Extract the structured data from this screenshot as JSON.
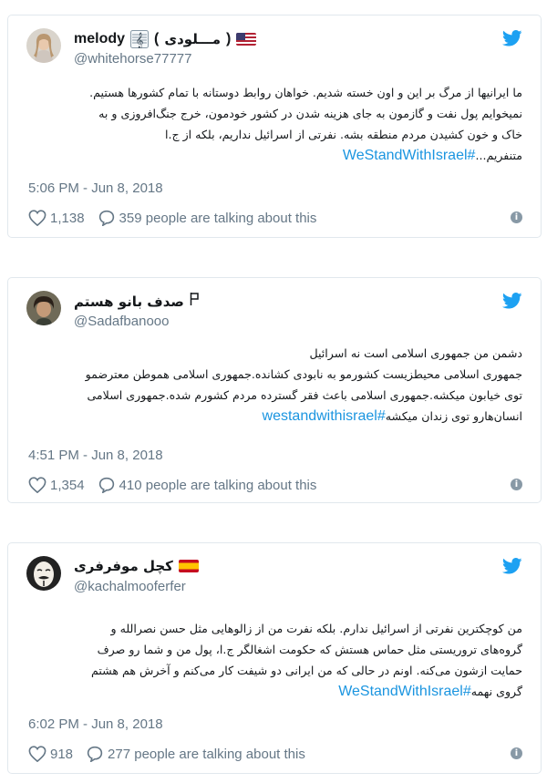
{
  "tweets": [
    {
      "display_name": "melody",
      "name_extra_open": "(",
      "name_rtl": "مـــلودی",
      "name_extra_close": ")",
      "handle": "@whitehorse77777",
      "lines": [
        "ما ایرانیها از مرگ بر این و اون خسته شدیم. خواهان روابط دوستانه با تمام کشورها هستیم.",
        "نمیخوایم پول نفت و گازمون به جای هزینه شدن در کشور خودمون، خرج جنگ‌افروزی و به",
        "خاک و خون کشیدن مردم منطقه بشه. نفرتی از اسرائیل نداریم، بلکه از ج.ا",
        "متنفریم..."
      ],
      "hashtag": "#WeStandWithIsrael",
      "time": "5:06 PM - Jun 8, 2018",
      "likes": "1,138",
      "talking": "359 people are talking about this"
    },
    {
      "display_name": "صدف بانو هستم",
      "handle": "@Sadafbanooo",
      "lines": [
        "دشمن من جمهوری اسلامی است نه اسرائیل",
        "جمهوری اسلامی محیطزیست کشورمو به نابودی کشانده.جمهوری اسلامی هموطن معترضمو",
        "توی خیابون میکشه.جمهوری اسلامی باعث فقر گسترده مردم کشورم شده.جمهوری اسلامی",
        "انسان‌هارو توی زندان میکشه"
      ],
      "hashtag": "#westandwithisrael",
      "time": "4:51 PM - Jun 8, 2018",
      "likes": "1,354",
      "talking": "410 people are talking about this"
    },
    {
      "display_name": "کچل موفرفری",
      "handle": "@kachalmooferfer",
      "lines": [
        "من کوچکترین نفرتی از اسرائیل ندارم. بلکه نفرت من از زالوهایی مثل حسن نصرالله و",
        "گروه‌های تروریستی مثل حماس هستش که حکومت اشغالگر ج.ا، پول من و شما رو صرف",
        "حمایت ازشون می‌کنه. اونم در حالی که من ایرانی دو شیفت کار می‌کنم و آخرش هم هشتم",
        "گروی نهمه"
      ],
      "hashtag": "#WeStandWithIsrael",
      "time": "6:02 PM - Jun 8, 2018",
      "likes": "918",
      "talking": "277 people are talking about this"
    }
  ],
  "colors": {
    "link": "#1b95e0",
    "muted": "#657786",
    "border": "#e1e8ed",
    "bird": "#1da1f2"
  },
  "icons": [
    "avatar",
    "treble-clef-icon",
    "us-flag-icon",
    "spain-flag-icon",
    "flag-icon",
    "twitter-bird-icon",
    "heart-icon",
    "comment-icon",
    "info-icon"
  ]
}
